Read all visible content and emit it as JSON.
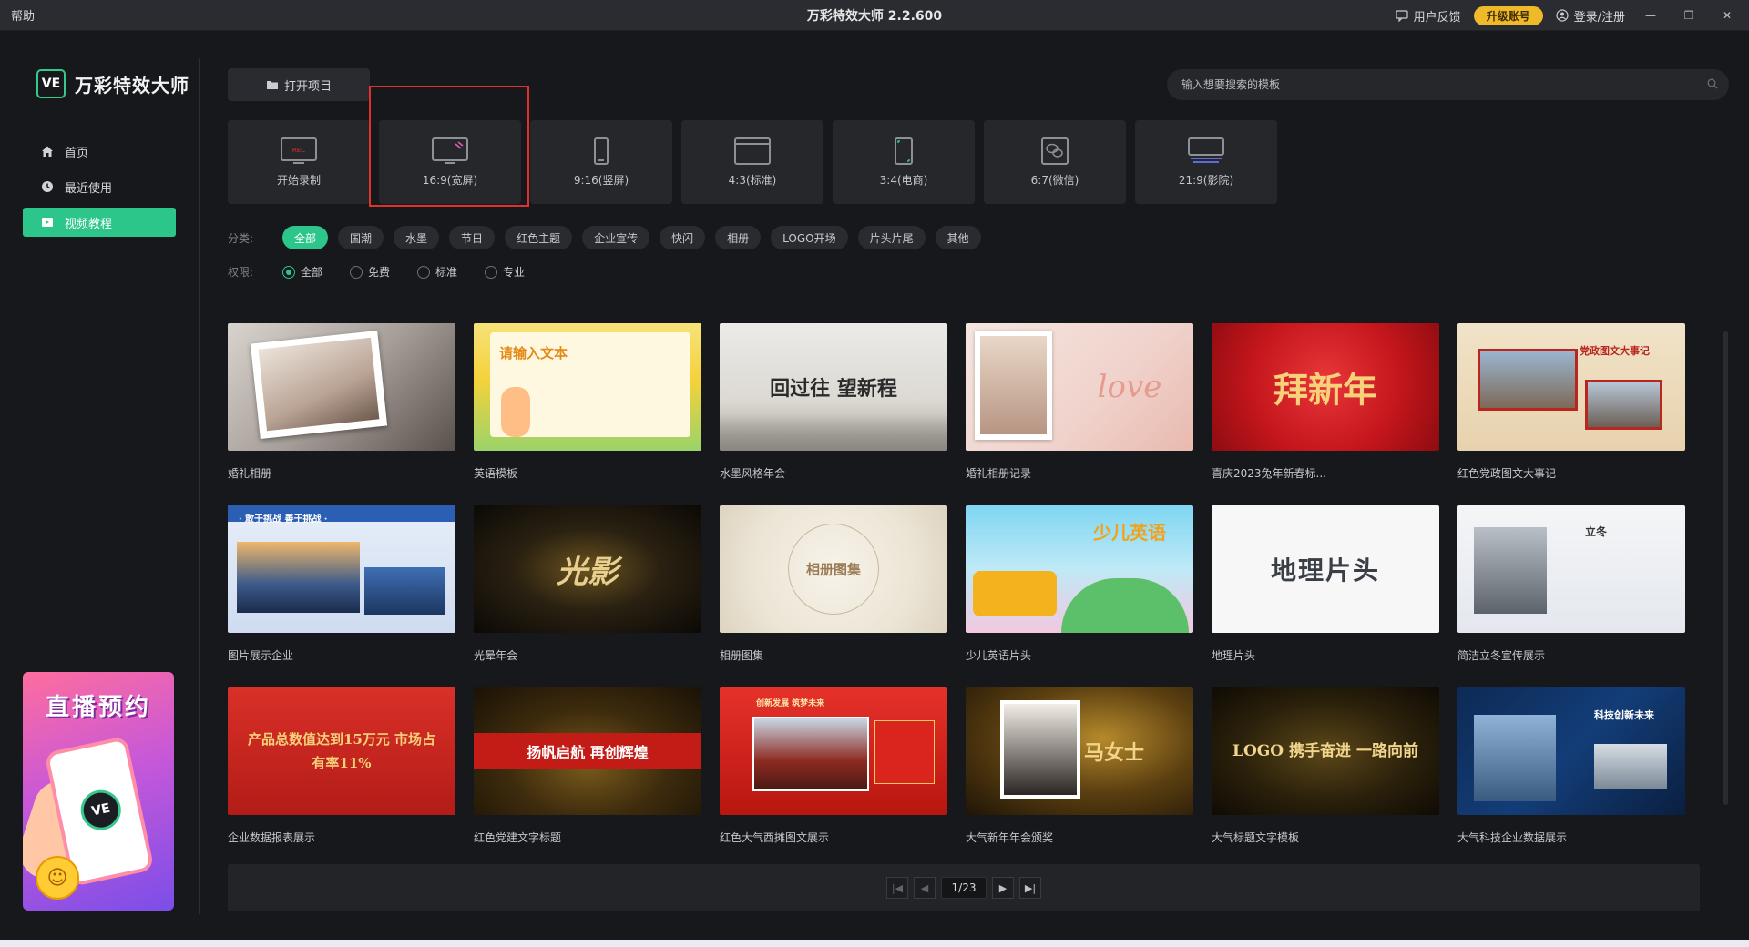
{
  "titlebar": {
    "help": "帮助",
    "title": "万彩特效大师 2.2.600",
    "feedback": "用户反馈",
    "upgrade": "升级账号",
    "login": "登录/注册"
  },
  "sidebar": {
    "logo_mark": "VE",
    "logo_name": "万彩特效大师",
    "items": [
      {
        "label": "首页",
        "icon": "home-icon"
      },
      {
        "label": "最近使用",
        "icon": "clock-icon"
      },
      {
        "label": "视频教程",
        "icon": "video-icon"
      }
    ],
    "promo_title": "直播预约",
    "promo_badge": "VE"
  },
  "main": {
    "open_project": "打开项目",
    "search_placeholder": "输入想要搜索的模板",
    "formats": [
      {
        "label": "开始录制",
        "icon": "rec-icon"
      },
      {
        "label": "16:9(宽屏)",
        "icon": "widescreen-icon"
      },
      {
        "label": "9:16(竖屏)",
        "icon": "portrait-icon"
      },
      {
        "label": "4:3(标准)",
        "icon": "standard-icon"
      },
      {
        "label": "3:4(电商)",
        "icon": "ecommerce-icon"
      },
      {
        "label": "6:7(微信)",
        "icon": "wechat-icon"
      },
      {
        "label": "21:9(影院)",
        "icon": "cinema-icon"
      }
    ],
    "category_label": "分类:",
    "categories": [
      "全部",
      "国潮",
      "水墨",
      "节日",
      "红色主题",
      "企业宣传",
      "快闪",
      "相册",
      "LOGO开场",
      "片头片尾",
      "其他"
    ],
    "permission_label": "权限:",
    "permissions": [
      "全部",
      "免费",
      "标准",
      "专业"
    ],
    "templates": [
      {
        "label": "婚礼相册",
        "thumb_text": ""
      },
      {
        "label": "英语模板",
        "thumb_text": "请输入文本"
      },
      {
        "label": "水墨风格年会",
        "thumb_text": "回过往 望新程"
      },
      {
        "label": "婚礼相册记录",
        "thumb_text": "love"
      },
      {
        "label": "喜庆2023兔年新春标...",
        "thumb_text": "拜新年"
      },
      {
        "label": "红色党政图文大事记",
        "thumb_text": "党政图文大事记"
      },
      {
        "label": "图片展示企业",
        "thumb_text": "· 敢于挑战 善于挑战 ·"
      },
      {
        "label": "光晕年会",
        "thumb_text": "光影"
      },
      {
        "label": "相册图集",
        "thumb_text": "相册图集"
      },
      {
        "label": "少儿英语片头",
        "thumb_text": "少儿英语"
      },
      {
        "label": "地理片头",
        "thumb_text": "地理片头"
      },
      {
        "label": "简洁立冬宣传展示",
        "thumb_text": "立冬"
      },
      {
        "label": "企业数据报表展示",
        "thumb_text": "产品总数值达到15万元 市场占有率11%"
      },
      {
        "label": "红色党建文字标题",
        "thumb_text": "扬帆启航 再创辉煌"
      },
      {
        "label": "红色大气西摊图文展示",
        "thumb_text": "创新发展 筑梦未来"
      },
      {
        "label": "大气新年年会颁奖",
        "thumb_text": "马女士"
      },
      {
        "label": "大气标题文字模板",
        "thumb_text": "LOGO 携手奋进 一路向前"
      },
      {
        "label": "大气科技企业数据展示",
        "thumb_text": "科技创新未来"
      }
    ],
    "pager": {
      "current": "1/23"
    }
  }
}
